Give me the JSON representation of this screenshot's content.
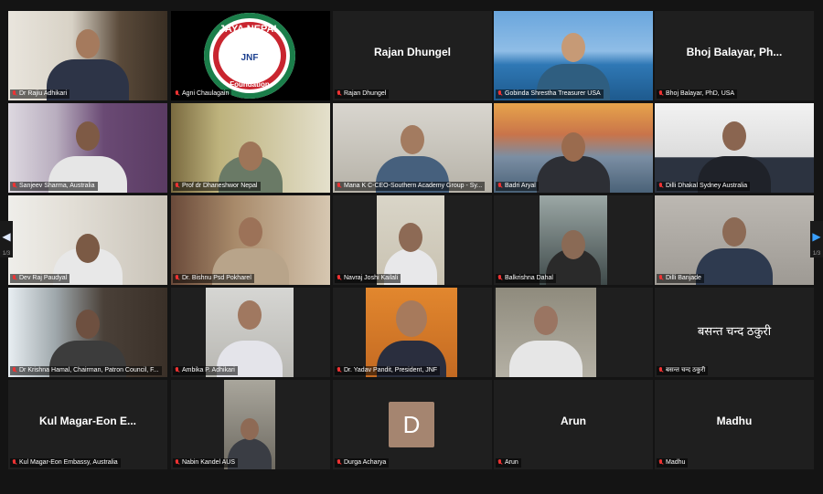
{
  "participants": [
    {
      "label": "Dr Rajiu Adhikari"
    },
    {
      "label": "Agni Chaulagain",
      "logo": {
        "line1": "JAYA NEPAL",
        "line2": "JNF",
        "line3": "Foundation",
        "left": "ESTD",
        "right": "2022"
      }
    },
    {
      "label": "Rajan Dhungel",
      "display": "Rajan Dhungel"
    },
    {
      "label": "Gobinda Shrestha Treasurer USA"
    },
    {
      "label": "Bhoj Balayar, PhD, USA",
      "display": "Bhoj Balayar, Ph..."
    },
    {
      "label": "Sanjeev Sharma, Australia"
    },
    {
      "label": "Prof dr Dhaneshwor Nepal"
    },
    {
      "label": "Mana K C-CEO-Southern Academy Group - Sy..."
    },
    {
      "label": "Badri Aryal"
    },
    {
      "label": "Dilli Dhakal Sydney Australia"
    },
    {
      "label": "Dev Raj Paudyal"
    },
    {
      "label": "Dr. Bishnu Psd Pokharel"
    },
    {
      "label": "Navraj Joshi Kailali"
    },
    {
      "label": "Balkrishna Dahal"
    },
    {
      "label": "Dilli Banjade"
    },
    {
      "label": "Dr Krishna Hamal, Chairman, Patron Council, F..."
    },
    {
      "label": "Ambika P. Adhikari"
    },
    {
      "label": "Dr. Yadav Pandit, President, JNF"
    },
    {
      "label": ""
    },
    {
      "label": "बसन्त चन्द ठकुरी",
      "display": "बसन्त चन्द ठकुरी"
    },
    {
      "label": "Kul Magar-Eon Embassy, Australia",
      "display": "Kul Magar-Eon E..."
    },
    {
      "label": "Nabin Kandel AUS"
    },
    {
      "label": "Durga Acharya",
      "avatar": "D"
    },
    {
      "label": "Arun",
      "display": "Arun"
    },
    {
      "label": "Madhu",
      "display": "Madhu"
    }
  ],
  "navigation": {
    "left_arrow": "◀",
    "left_page": "1/3",
    "right_arrow": "▶",
    "right_page": "1/3"
  },
  "colors": {
    "active_speaker_border": "#d8e64c",
    "muted_mic": "#e33333",
    "tile_background": "#1f1f1f"
  }
}
